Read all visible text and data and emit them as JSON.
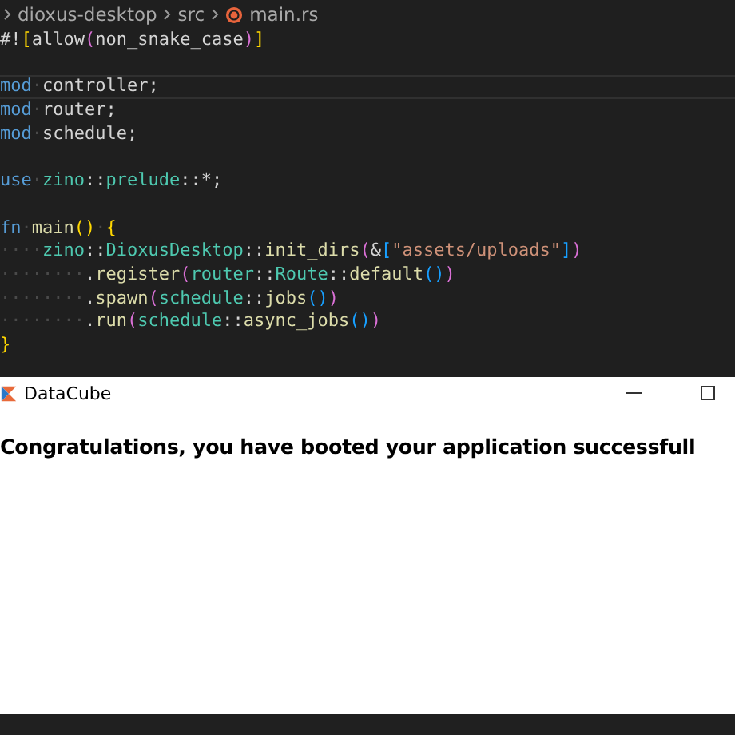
{
  "editor": {
    "breadcrumb": [
      "dioxus-desktop",
      "src",
      "main.rs"
    ],
    "lines": [
      {
        "current": false,
        "tokens": [
          {
            "t": "#!",
            "kind": "plain"
          },
          {
            "t": "[",
            "kind": "b1"
          },
          {
            "t": "allow",
            "kind": "plain"
          },
          {
            "t": "(",
            "kind": "b2"
          },
          {
            "t": "non_snake_case",
            "kind": "plain"
          },
          {
            "t": ")",
            "kind": "b2"
          },
          {
            "t": "]",
            "kind": "b1"
          }
        ]
      },
      {
        "current": false
      },
      {
        "current": true,
        "tokens": [
          {
            "t": "mod",
            "kind": "keyword"
          },
          {
            "t": "·",
            "kind": "ws"
          },
          {
            "t": "controller;",
            "kind": "plain"
          }
        ]
      },
      {
        "current": false,
        "tokens": [
          {
            "t": "mod",
            "kind": "keyword"
          },
          {
            "t": "·",
            "kind": "ws"
          },
          {
            "t": "router;",
            "kind": "plain"
          }
        ]
      },
      {
        "current": false,
        "tokens": [
          {
            "t": "mod",
            "kind": "keyword"
          },
          {
            "t": "·",
            "kind": "ws"
          },
          {
            "t": "schedule;",
            "kind": "plain"
          }
        ]
      },
      {
        "current": false
      },
      {
        "current": false,
        "tokens": [
          {
            "t": "use",
            "kind": "keyword"
          },
          {
            "t": "·",
            "kind": "ws"
          },
          {
            "t": "zino",
            "kind": "type"
          },
          {
            "t": "::",
            "kind": "plain"
          },
          {
            "t": "prelude",
            "kind": "type"
          },
          {
            "t": "::*;",
            "kind": "plain"
          }
        ]
      },
      {
        "current": false
      },
      {
        "current": false,
        "tokens": [
          {
            "t": "fn",
            "kind": "keyword"
          },
          {
            "t": "·",
            "kind": "ws"
          },
          {
            "t": "main",
            "kind": "func"
          },
          {
            "t": "()",
            "kind": "b1"
          },
          {
            "t": "·",
            "kind": "ws"
          },
          {
            "t": "{",
            "kind": "b1"
          }
        ]
      },
      {
        "current": false,
        "tokens": [
          {
            "t": "····",
            "kind": "ws"
          },
          {
            "t": "zino",
            "kind": "type"
          },
          {
            "t": "::",
            "kind": "plain"
          },
          {
            "t": "DioxusDesktop",
            "kind": "type"
          },
          {
            "t": "::",
            "kind": "plain"
          },
          {
            "t": "init_dirs",
            "kind": "func"
          },
          {
            "t": "(",
            "kind": "b2"
          },
          {
            "t": "&",
            "kind": "plain"
          },
          {
            "t": "[",
            "kind": "b3"
          },
          {
            "t": "\"assets/uploads\"",
            "kind": "string"
          },
          {
            "t": "]",
            "kind": "b3"
          },
          {
            "t": ")",
            "kind": "b2"
          }
        ]
      },
      {
        "current": false,
        "tokens": [
          {
            "t": "········",
            "kind": "ws"
          },
          {
            "t": ".",
            "kind": "plain"
          },
          {
            "t": "register",
            "kind": "func"
          },
          {
            "t": "(",
            "kind": "b2"
          },
          {
            "t": "router",
            "kind": "type"
          },
          {
            "t": "::",
            "kind": "plain"
          },
          {
            "t": "Route",
            "kind": "type"
          },
          {
            "t": "::",
            "kind": "plain"
          },
          {
            "t": "default",
            "kind": "func"
          },
          {
            "t": "()",
            "kind": "b3"
          },
          {
            "t": ")",
            "kind": "b2"
          }
        ]
      },
      {
        "current": false,
        "tokens": [
          {
            "t": "········",
            "kind": "ws"
          },
          {
            "t": ".",
            "kind": "plain"
          },
          {
            "t": "spawn",
            "kind": "func"
          },
          {
            "t": "(",
            "kind": "b2"
          },
          {
            "t": "schedule",
            "kind": "type"
          },
          {
            "t": "::",
            "kind": "plain"
          },
          {
            "t": "jobs",
            "kind": "func"
          },
          {
            "t": "()",
            "kind": "b3"
          },
          {
            "t": ")",
            "kind": "b2"
          }
        ]
      },
      {
        "current": false,
        "tokens": [
          {
            "t": "········",
            "kind": "ws"
          },
          {
            "t": ".",
            "kind": "plain"
          },
          {
            "t": "run",
            "kind": "func"
          },
          {
            "t": "(",
            "kind": "b2"
          },
          {
            "t": "schedule",
            "kind": "type"
          },
          {
            "t": "::",
            "kind": "plain"
          },
          {
            "t": "async_jobs",
            "kind": "func"
          },
          {
            "t": "()",
            "kind": "b3"
          },
          {
            "t": ")",
            "kind": "b2"
          }
        ]
      },
      {
        "current": false,
        "tokens": [
          {
            "t": "}",
            "kind": "b1"
          }
        ]
      }
    ]
  },
  "app_window": {
    "title": "DataCube",
    "heading": "Congratulations, you have booted your application successfull"
  }
}
